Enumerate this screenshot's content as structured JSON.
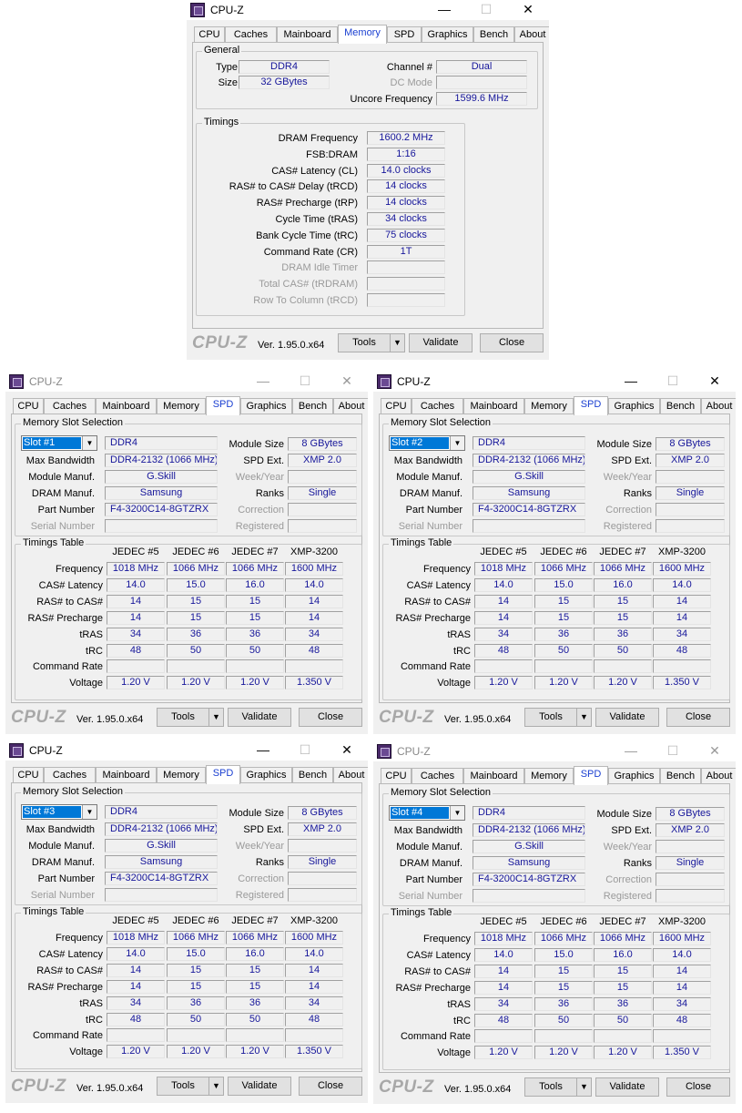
{
  "app": {
    "title": "CPU-Z",
    "version": "Ver. 1.95.0.x64",
    "logo": "CPU-Z",
    "tabs": [
      "CPU",
      "Caches",
      "Mainboard",
      "Memory",
      "SPD",
      "Graphics",
      "Bench",
      "About"
    ],
    "buttons": {
      "tools": "Tools",
      "validate": "Validate",
      "close": "Close"
    },
    "window_controls": {
      "minimize": "—",
      "maximize": "☐",
      "close": "✕"
    },
    "accent_value_color": "#16169a",
    "selected_tab_color": "#1a3fd1"
  },
  "memory": {
    "general_title": "General",
    "type_label": "Type",
    "type_value": "DDR4",
    "size_label": "Size",
    "size_value": "32 GBytes",
    "channel_label": "Channel #",
    "channel_value": "Dual",
    "dcmode_label": "DC Mode",
    "dcmode_value": "",
    "uncore_label": "Uncore Frequency",
    "uncore_value": "1599.6 MHz",
    "timings_title": "Timings",
    "timings": [
      {
        "label": "DRAM Frequency",
        "value": "1600.2 MHz"
      },
      {
        "label": "FSB:DRAM",
        "value": "1:16"
      },
      {
        "label": "CAS# Latency (CL)",
        "value": "14.0 clocks"
      },
      {
        "label": "RAS# to CAS# Delay (tRCD)",
        "value": "14 clocks"
      },
      {
        "label": "RAS# Precharge (tRP)",
        "value": "14 clocks"
      },
      {
        "label": "Cycle Time (tRAS)",
        "value": "34 clocks"
      },
      {
        "label": "Bank Cycle Time (tRC)",
        "value": "75 clocks"
      },
      {
        "label": "Command Rate (CR)",
        "value": "1T"
      },
      {
        "label": "DRAM Idle Timer",
        "value": ""
      },
      {
        "label": "Total CAS# (tRDRAM)",
        "value": ""
      },
      {
        "label": "Row To Column (tRCD)",
        "value": ""
      }
    ]
  },
  "spd": {
    "slot_section": "Memory Slot Selection",
    "labels": {
      "max_bandwidth": "Max Bandwidth",
      "module_manuf": "Module Manuf.",
      "dram_manuf": "DRAM Manuf.",
      "part_number": "Part Number",
      "serial_number": "Serial Number",
      "module_size": "Module Size",
      "spd_ext": "SPD Ext.",
      "week_year": "Week/Year",
      "ranks": "Ranks",
      "correction": "Correction",
      "registered": "Registered"
    },
    "timings_table_title": "Timings Table",
    "columns": [
      "JEDEC #5",
      "JEDEC #6",
      "JEDEC #7",
      "XMP-3200"
    ],
    "row_labels": [
      "Frequency",
      "CAS# Latency",
      "RAS# to CAS#",
      "RAS# Precharge",
      "tRAS",
      "tRC",
      "Command Rate",
      "Voltage"
    ],
    "rows": [
      [
        "1018 MHz",
        "1066 MHz",
        "1066 MHz",
        "1600 MHz"
      ],
      [
        "14.0",
        "15.0",
        "16.0",
        "14.0"
      ],
      [
        "14",
        "15",
        "15",
        "14"
      ],
      [
        "14",
        "15",
        "15",
        "14"
      ],
      [
        "34",
        "36",
        "36",
        "34"
      ],
      [
        "48",
        "50",
        "50",
        "48"
      ],
      [
        "",
        "",
        "",
        ""
      ],
      [
        "1.20 V",
        "1.20 V",
        "1.20 V",
        "1.350 V"
      ]
    ],
    "slots": [
      {
        "slot": "Slot #1",
        "type": "DDR4",
        "max_bandwidth": "DDR4-2132 (1066 MHz)",
        "module_manuf": "G.Skill",
        "dram_manuf": "Samsung",
        "part_number": "F4-3200C14-8GTZRX",
        "serial_number": "",
        "module_size": "8 GBytes",
        "spd_ext": "XMP 2.0",
        "week_year": "",
        "ranks": "Single",
        "correction": "",
        "registered": ""
      },
      {
        "slot": "Slot #2",
        "type": "DDR4",
        "max_bandwidth": "DDR4-2132 (1066 MHz)",
        "module_manuf": "G.Skill",
        "dram_manuf": "Samsung",
        "part_number": "F4-3200C14-8GTZRX",
        "serial_number": "",
        "module_size": "8 GBytes",
        "spd_ext": "XMP 2.0",
        "week_year": "",
        "ranks": "Single",
        "correction": "",
        "registered": ""
      },
      {
        "slot": "Slot #3",
        "type": "DDR4",
        "max_bandwidth": "DDR4-2132 (1066 MHz)",
        "module_manuf": "G.Skill",
        "dram_manuf": "Samsung",
        "part_number": "F4-3200C14-8GTZRX",
        "serial_number": "",
        "module_size": "8 GBytes",
        "spd_ext": "XMP 2.0",
        "week_year": "",
        "ranks": "Single",
        "correction": "",
        "registered": ""
      },
      {
        "slot": "Slot #4",
        "type": "DDR4",
        "max_bandwidth": "DDR4-2132 (1066 MHz)",
        "module_manuf": "G.Skill",
        "dram_manuf": "Samsung",
        "part_number": "F4-3200C14-8GTZRX",
        "serial_number": "",
        "module_size": "8 GBytes",
        "spd_ext": "XMP 2.0",
        "week_year": "",
        "ranks": "Single",
        "correction": "",
        "registered": ""
      }
    ]
  }
}
